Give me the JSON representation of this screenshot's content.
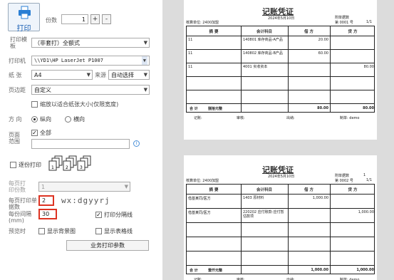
{
  "left": {
    "print_label": "打印",
    "copies_label": "份数",
    "copies_value": "1",
    "plus": "+",
    "minus": "-",
    "template_label": "打印模板",
    "template_value": "（非套打）全额式",
    "printer_label": "打印机",
    "printer_value": "\\\\YD1\\HP LaserJet P1007",
    "paper_label": "纸 张",
    "paper_value": "A4",
    "source_label": "来源",
    "source_value": "自动选择",
    "margin_label": "页边距",
    "margin_value": "自定义",
    "shrink_label": "缩放以适合纸张大小(仅限宽度)",
    "direction_label": "方 向",
    "portrait_label": "纵向",
    "landscape_label": "横向",
    "range_label": "页面范围",
    "all_label": "全部",
    "collate_label": "逐份打印",
    "per_page_label": "每页打印份数",
    "per_page_value": "1",
    "per_print_label": "每页打印单据数",
    "per_print_value": "2",
    "watermark": "wx:dgyyrj",
    "gap_label": "每份间隔(mm)",
    "gap_value": "30",
    "sepline_label": "打印分隔线",
    "preview_label": "预览时",
    "show_bg_label": "显示背景图",
    "show_grid_label": "显示表格线",
    "biz_button": "业务打印参数"
  },
  "vouchers": [
    {
      "title": "记账凭证",
      "date": "2024年5月10日",
      "unit": "核算单位: 2400加盟",
      "attach": "附单据数",
      "attach_count": "",
      "number": "第  0001  号",
      "pages": "1/1",
      "headers": [
        "摘 要",
        "会计科目",
        "借 方",
        "贷 方"
      ],
      "rows": [
        {
          "summary": "11",
          "account": "140801 库存商品-A产品",
          "debit": "20.00",
          "credit": ""
        },
        {
          "summary": "11",
          "account": "140802 库存商品-B产品",
          "debit": "60.00",
          "credit": ""
        },
        {
          "summary": "11",
          "account": "4001 实收资本",
          "debit": "",
          "credit": "80.00"
        }
      ],
      "total_label": "合 计",
      "total_words": "捌拾元整",
      "total_debit": "80.00",
      "total_credit": "80.00",
      "sign": [
        "记账:",
        "审核:",
        "出纳:",
        "制单: demo"
      ]
    },
    {
      "title": "记账凭证",
      "date": "2024年5月10日",
      "unit": "核算单位: 2400加盟",
      "attach": "附单据数",
      "attach_count": "1",
      "number": "第  0002  号",
      "pages": "1/1",
      "headers": [
        "摘 要",
        "会计科目",
        "借 方",
        "贷 方"
      ],
      "rows": [
        {
          "summary": "借基某同/医方",
          "account": "1403 原材料",
          "debit": "1,000.00",
          "credit": ""
        },
        {
          "summary": "借基某同/医方",
          "account": "220202 应付账款-应付暂估款项",
          "debit": "",
          "credit": "1,000.00"
        }
      ],
      "total_label": "合 计",
      "total_words": "壹仟元整",
      "total_debit": "1,000.00",
      "total_credit": "1,000.00",
      "sign": [
        "记账:",
        "审核:",
        "出纳:",
        "制单: demo"
      ]
    }
  ]
}
